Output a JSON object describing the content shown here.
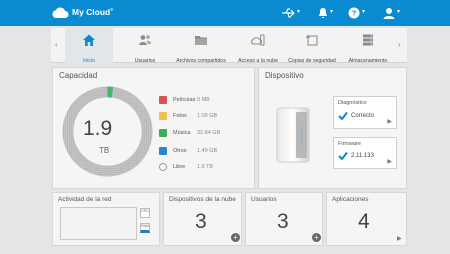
{
  "app": {
    "brand": "My Cloud",
    "trademark": "®",
    "colors": {
      "accent": "#0a8ad0",
      "donut_used": "#46b66e",
      "donut_free": "#bdbdbd"
    }
  },
  "topbar": {
    "icons": [
      "usb-icon",
      "bell-icon",
      "help-icon",
      "user-icon"
    ]
  },
  "nav": {
    "items": [
      {
        "label": "Inicio",
        "icon": "home-icon",
        "active": true
      },
      {
        "label": "Usuarios",
        "icon": "users-icon"
      },
      {
        "label": "Archivos compartidos",
        "icon": "folder-icon"
      },
      {
        "label": "Acceso a la nube",
        "icon": "cloud-devices-icon"
      },
      {
        "label": "Copias de seguridad",
        "icon": "backup-icon"
      },
      {
        "label": "Almacenamiento",
        "icon": "storage-icon"
      }
    ]
  },
  "capacity": {
    "title": "Capacidad",
    "total": "1.9",
    "unit": "TB",
    "used_fraction": 0.02,
    "legend": [
      {
        "name": "Películas",
        "value": "0 MB",
        "icon": "film-icon",
        "color": "#d9534f"
      },
      {
        "name": "Fotos",
        "value": "1.09 GB",
        "icon": "photo-icon",
        "color": "#f0c14b"
      },
      {
        "name": "Música",
        "value": "32.84 GB",
        "icon": "music-icon",
        "color": "#3fae5a"
      },
      {
        "name": "Otros",
        "value": "1.49 GB",
        "icon": "other-icon",
        "color": "#2f86c9"
      },
      {
        "name": "Libre",
        "value": "1.9 TB",
        "icon": "free-icon",
        "color": "#9a9a9a"
      }
    ]
  },
  "device": {
    "title": "Dispositivo",
    "diagnostics": {
      "title": "Diagnóstico",
      "value": "Correcto"
    },
    "firmware": {
      "title": "Firmware",
      "value": "2.11.133"
    }
  },
  "bottom": {
    "network": {
      "title": "Actividad de la red",
      "cpu_label": "CPU",
      "ram_label": "RAM"
    },
    "cloud_devices": {
      "title": "Dispositivos de la nube",
      "count": "3"
    },
    "users": {
      "title": "Usuarios",
      "count": "3"
    },
    "apps": {
      "title": "Aplicaciones",
      "count": "4"
    }
  }
}
